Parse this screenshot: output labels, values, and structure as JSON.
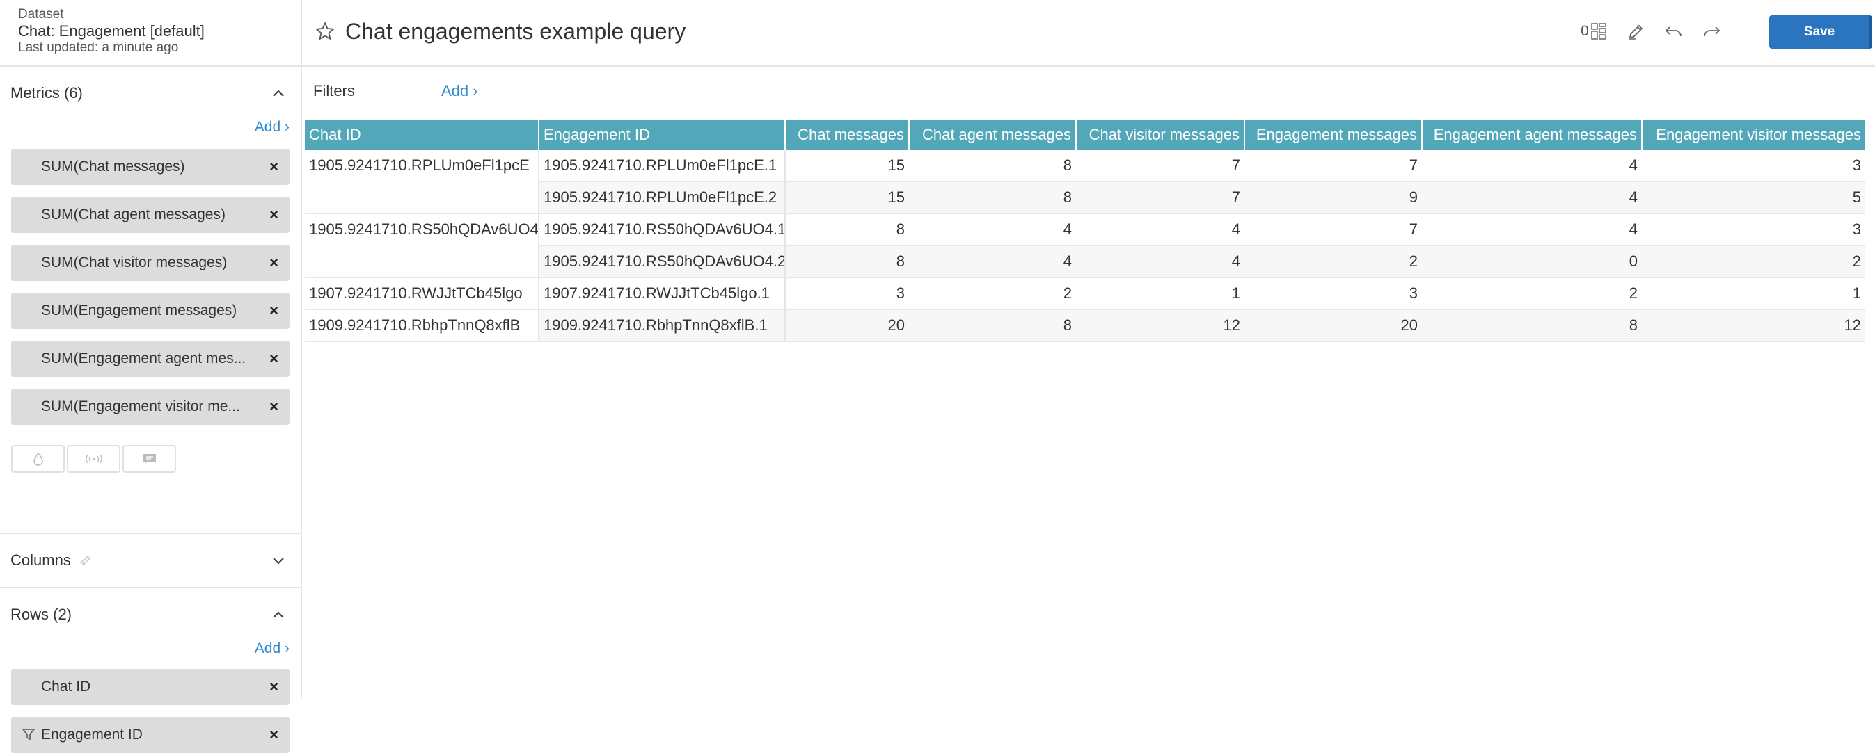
{
  "dataset": {
    "label": "Dataset",
    "name": "Chat: Engagement [default]",
    "updated": "Last updated: a minute ago"
  },
  "header": {
    "title": "Chat engagements example query",
    "badge_count": "0",
    "save_label": "Save"
  },
  "metrics": {
    "title": "Metrics (6)",
    "add_label": "Add ›",
    "items": [
      "SUM(Chat messages)",
      "SUM(Chat agent messages)",
      "SUM(Chat visitor messages)",
      "SUM(Engagement messages)",
      "SUM(Engagement agent mes...",
      "SUM(Engagement visitor me..."
    ]
  },
  "columns": {
    "title": "Columns"
  },
  "rows": {
    "title": "Rows (2)",
    "add_label": "Add ›",
    "items": [
      "Chat ID",
      "Engagement ID"
    ]
  },
  "filters": {
    "label": "Filters",
    "add_label": "Add ›"
  },
  "table": {
    "headers": [
      "Chat ID",
      "Engagement ID",
      "Chat messages",
      "Chat agent messages",
      "Chat visitor messages",
      "Engagement messages",
      "Engagement agent messages",
      "Engagement visitor messages"
    ],
    "rows": [
      [
        "1905.9241710.RPLUm0eFl1pcE",
        "1905.9241710.RPLUm0eFl1pcE.1",
        "15",
        "8",
        "7",
        "7",
        "4",
        "3"
      ],
      [
        "",
        "1905.9241710.RPLUm0eFl1pcE.2",
        "15",
        "8",
        "7",
        "9",
        "4",
        "5"
      ],
      [
        "1905.9241710.RS50hQDAv6UO4",
        "1905.9241710.RS50hQDAv6UO4.1",
        "8",
        "4",
        "4",
        "7",
        "4",
        "3"
      ],
      [
        "",
        "1905.9241710.RS50hQDAv6UO4.2",
        "8",
        "4",
        "4",
        "2",
        "0",
        "2"
      ],
      [
        "1907.9241710.RWJJtTCb45lgo",
        "1907.9241710.RWJJtTCb45lgo.1",
        "3",
        "2",
        "1",
        "3",
        "2",
        "1"
      ],
      [
        "1909.9241710.RbhpTnnQ8xflB",
        "1909.9241710.RbhpTnnQ8xflB.1",
        "20",
        "8",
        "12",
        "20",
        "8",
        "12"
      ]
    ]
  },
  "colors": {
    "header_bg": "#52a7b8",
    "accent": "#2d8bd1",
    "save_bg": "#2b74c0"
  }
}
